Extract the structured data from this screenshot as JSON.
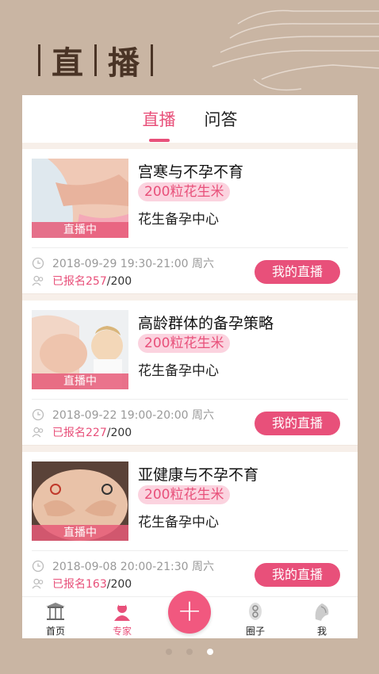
{
  "header": {
    "chars": [
      "直",
      "播"
    ]
  },
  "tabs": [
    {
      "label": "直播",
      "active": true
    },
    {
      "label": "问答",
      "active": false
    }
  ],
  "cards": [
    {
      "title": "宫寒与不孕不育",
      "badge": "200粒花生米",
      "org": "花生备孕中心",
      "status": "直播中",
      "datetime": "2018-09-29 19:30-21:00 周六",
      "registered": "已报名257",
      "capacity": "/200",
      "button": "我的直播"
    },
    {
      "title": "高龄群体的备孕策略",
      "badge": "200粒花生米",
      "org": "花生备孕中心",
      "status": "直播中",
      "datetime": "2018-09-22 19:00-20:00 周六",
      "registered": "已报名227",
      "capacity": "/200",
      "button": "我的直播"
    },
    {
      "title": "亚健康与不孕不育",
      "badge": "200粒花生米",
      "org": "花生备孕中心",
      "status": "直播中",
      "datetime": "2018-09-08 20:00-21:30 周六",
      "registered": "已报名163",
      "capacity": "/200",
      "button": "我的直播"
    }
  ],
  "nav": [
    {
      "label": "首页",
      "icon": "home-pavilion-icon"
    },
    {
      "label": "专家",
      "icon": "expert-icon",
      "active": true
    },
    {
      "label": "+",
      "icon": "add-icon"
    },
    {
      "label": "圈子",
      "icon": "circle-icon"
    },
    {
      "label": "我",
      "icon": "profile-icon"
    }
  ],
  "colors": {
    "accent": "#e8507a",
    "background": "#c9b5a3",
    "title": "#4a3426"
  },
  "pager": {
    "pages": 3,
    "active_index": 2
  }
}
